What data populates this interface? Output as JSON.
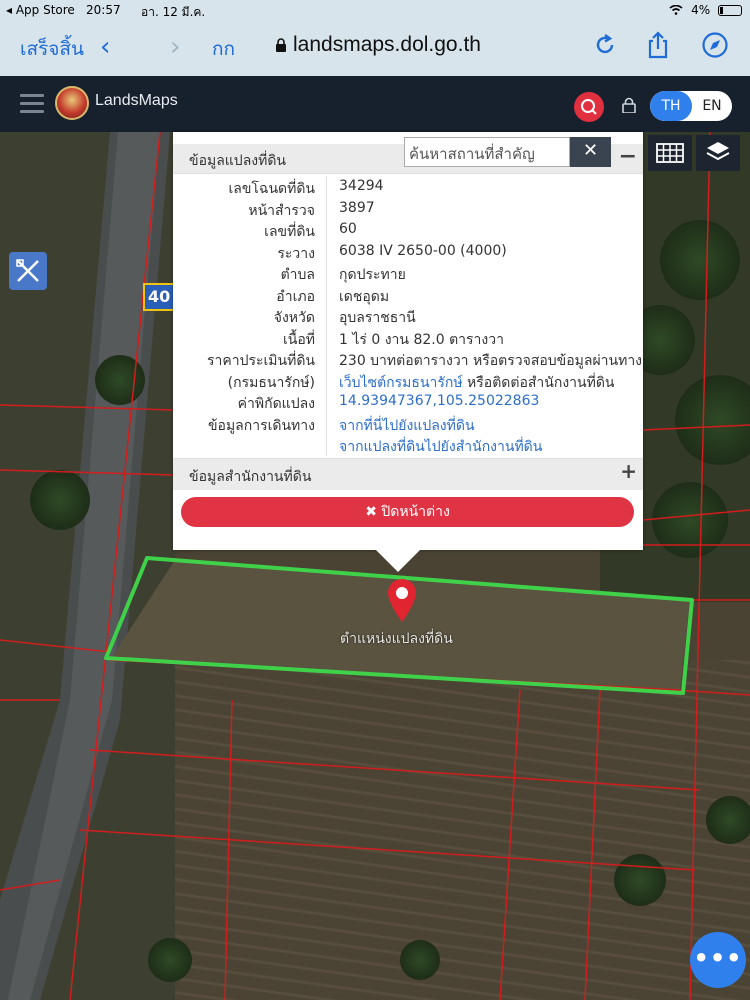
{
  "status_bar": {
    "back_app": "◂ App Store",
    "time": "20:57",
    "date": "อา. 12 มี.ค.",
    "battery": "4%"
  },
  "browser": {
    "done": "เสร็จสิ้น",
    "text_size": "กก",
    "url": "landsmaps.dol.go.th"
  },
  "app": {
    "brand": "LandsMaps",
    "lang_th": "TH",
    "lang_en": "EN",
    "road_sign": "40"
  },
  "landmark_search": {
    "placeholder": "ค้นหาสถานที่สำคัญ",
    "clear": "✕"
  },
  "panel": {
    "title": "ข้อมูลแปลงที่ดิน",
    "minimize": "−",
    "rows": [
      {
        "label": "เลขโฉนดที่ดิน",
        "value": "34294"
      },
      {
        "label": "หน้าสำรวจ",
        "value": "3897"
      },
      {
        "label": "เลขที่ดิน",
        "value": "60"
      },
      {
        "label": "ระวาง",
        "value": "6038 IV 2650-00 (4000)"
      },
      {
        "label": "ตำบล",
        "value": "กุดประทาย"
      },
      {
        "label": "อำเภอ",
        "value": "เดชอุดม"
      },
      {
        "label": "จังหวัด",
        "value": "อุบลราชธานี"
      },
      {
        "label": "เนื้อที่",
        "value": "1 ไร่ 0 งาน 82.0 ตารางวา"
      },
      {
        "label": "ราคาประเมินที่ดิน",
        "value": "230 บาทต่อตารางวา หรือตรวจสอบข้อมูลผ่านทาง"
      },
      {
        "label": "(กรมธนารักษ์)",
        "value_link": "เว็บไซต์กรมธนารักษ์",
        "value_rest": " หรือติดต่อสำนักงานที่ดิน"
      },
      {
        "label": "ค่าพิกัดแปลง",
        "value": "14.93947367,105.25022863"
      },
      {
        "label": "ข้อมูลการเดินทาง",
        "value": "จากที่นี่ไปยังแปลงที่ดิน"
      },
      {
        "label": "",
        "value": "จากแปลงที่ดินไปยังสำนักงานที่ดิน"
      }
    ],
    "office_section": "ข้อมูลสำนักงานที่ดิน",
    "expand": "+",
    "close_button": "✖ ปิดหน้าต่าง"
  },
  "map": {
    "parcel_label": "ตำแหน่งแปลงที่ดิน",
    "fab": "•••"
  },
  "colors": {
    "accent_blue": "#2f80ed",
    "close_red": "#e03344",
    "parcel_outline": "#3fd14a",
    "boundary": "#d21d1d",
    "header_bg": "#17202d"
  },
  "icons": [
    "back-chevron-icon",
    "forward-chevron-icon",
    "lock-icon",
    "reload-icon",
    "share-icon",
    "compass-icon",
    "hamburger-icon",
    "search-icon",
    "lock-icon",
    "ruler-tool-icon",
    "grid-icon",
    "layers-icon",
    "location-pin-icon",
    "more-icon"
  ]
}
